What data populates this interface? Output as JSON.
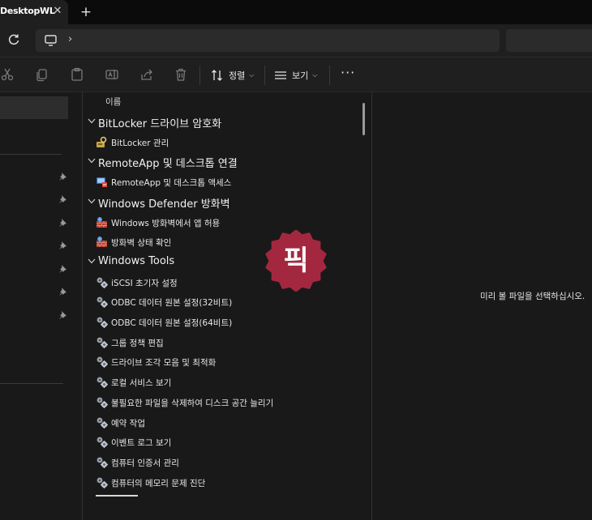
{
  "window": {
    "tab_title": "DesktopWL"
  },
  "toolbar": {
    "sort_label": "정렬",
    "view_label": "보기"
  },
  "list": {
    "column_header": "이름",
    "rows": [
      {
        "kind": "group",
        "label": "BitLocker 드라이브 암호화"
      },
      {
        "kind": "item",
        "icon": "bitlocker-key-icon",
        "label": "BitLocker 관리"
      },
      {
        "kind": "group",
        "label": "RemoteApp 및 데스크톱 연결"
      },
      {
        "kind": "item",
        "icon": "remote-desktop-icon",
        "label": "RemoteApp 및 데스크톱 액세스"
      },
      {
        "kind": "group",
        "label": "Windows Defender 방화벽"
      },
      {
        "kind": "item",
        "icon": "firewall-icon",
        "label": "Windows 방화벽에서 앱 허용"
      },
      {
        "kind": "item",
        "icon": "firewall-icon",
        "label": "방화벽 상태 확인"
      },
      {
        "kind": "group",
        "label": "Windows Tools"
      },
      {
        "kind": "item",
        "icon": "admin-tools-icon",
        "label": "iSCSI 초기자 설정"
      },
      {
        "kind": "item",
        "icon": "admin-tools-icon",
        "label": "ODBC 데이터 원본 설정(32비트)"
      },
      {
        "kind": "item",
        "icon": "admin-tools-icon",
        "label": "ODBC 데이터 원본 설정(64비트)"
      },
      {
        "kind": "item",
        "icon": "admin-tools-icon",
        "label": "그룹 정책 편집"
      },
      {
        "kind": "item",
        "icon": "admin-tools-icon",
        "label": "드라이브 조각 모음 및 최적화"
      },
      {
        "kind": "item",
        "icon": "admin-tools-icon",
        "label": "로컬 서비스 보기"
      },
      {
        "kind": "item",
        "icon": "admin-tools-icon",
        "label": "불필요한 파일을 삭제하여 디스크 공간 늘리기"
      },
      {
        "kind": "item",
        "icon": "admin-tools-icon",
        "label": "예약 작업"
      },
      {
        "kind": "item",
        "icon": "admin-tools-icon",
        "label": "이벤트 로그 보기"
      },
      {
        "kind": "item",
        "icon": "admin-tools-icon",
        "label": "컴퓨터 인증서 관리"
      },
      {
        "kind": "item",
        "icon": "admin-tools-icon",
        "label": "컴퓨터의 메모리 문제 진단"
      }
    ]
  },
  "preview": {
    "message": "미리 볼 파일을 선택하십시오."
  },
  "watermark": {
    "text": "픽",
    "color": "#a3283f"
  },
  "colors": {
    "background": "#191919",
    "toolbar": "#1f1f1f",
    "titlebar": "#0b0b0b",
    "text": "#e6e6e6"
  }
}
